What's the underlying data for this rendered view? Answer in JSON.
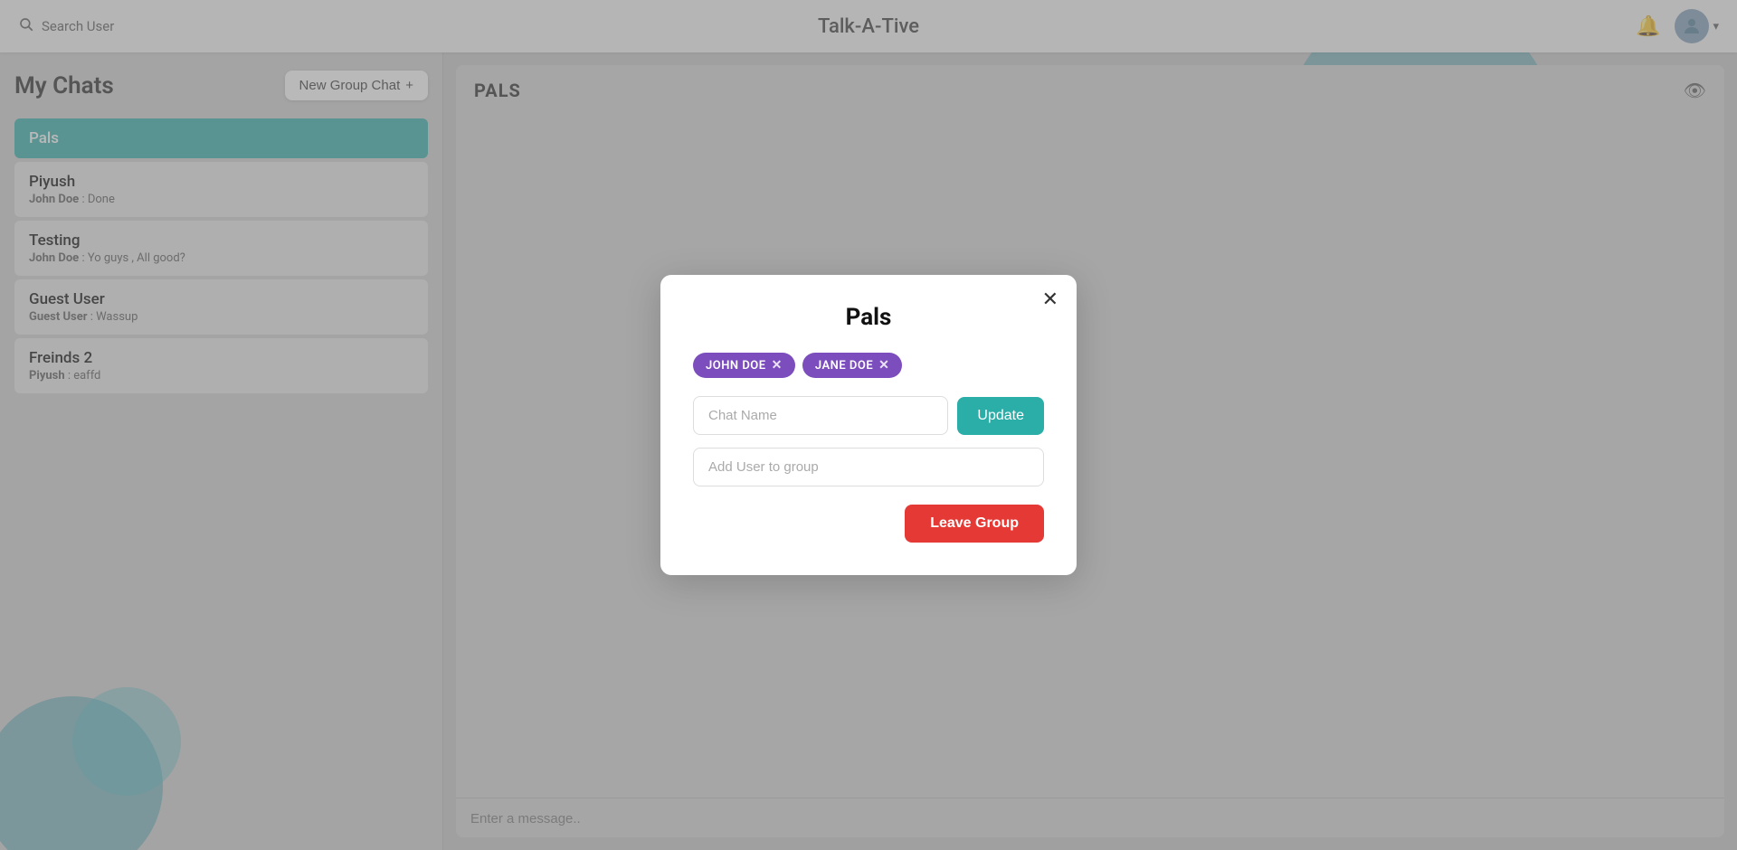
{
  "navbar": {
    "search_placeholder": "Search User",
    "title": "Talk-A-Tive",
    "bell_label": "notifications",
    "avatar_label": "user avatar",
    "dropdown_arrow": "▾"
  },
  "sidebar": {
    "title": "My Chats",
    "new_group_label": "New Group Chat",
    "new_group_icon": "+",
    "chats": [
      {
        "id": "pals",
        "name": "Pals",
        "preview": "",
        "active": true
      },
      {
        "id": "piyush",
        "name": "Piyush",
        "sender": "John Doe",
        "message": "Done",
        "active": false
      },
      {
        "id": "testing",
        "name": "Testing",
        "sender": "John Doe",
        "message": "Yo guys , All good?",
        "active": false
      },
      {
        "id": "guest",
        "name": "Guest User",
        "sender": "Guest User",
        "message": "Wassup",
        "active": false
      },
      {
        "id": "freinds2",
        "name": "Freinds 2",
        "sender": "Piyush",
        "message": "eaffd",
        "active": false
      }
    ]
  },
  "chat": {
    "title": "PALS",
    "message_placeholder": "Enter a message..",
    "eye_icon": "👁"
  },
  "modal": {
    "close_icon": "✕",
    "title": "Pals",
    "tags": [
      {
        "id": "john",
        "label": "JOHN DOE",
        "color": "purple"
      },
      {
        "id": "jane",
        "label": "JANE DOE",
        "color": "purple"
      }
    ],
    "chat_name_placeholder": "Chat Name",
    "update_label": "Update",
    "add_user_placeholder": "Add User to group",
    "leave_label": "Leave Group"
  }
}
